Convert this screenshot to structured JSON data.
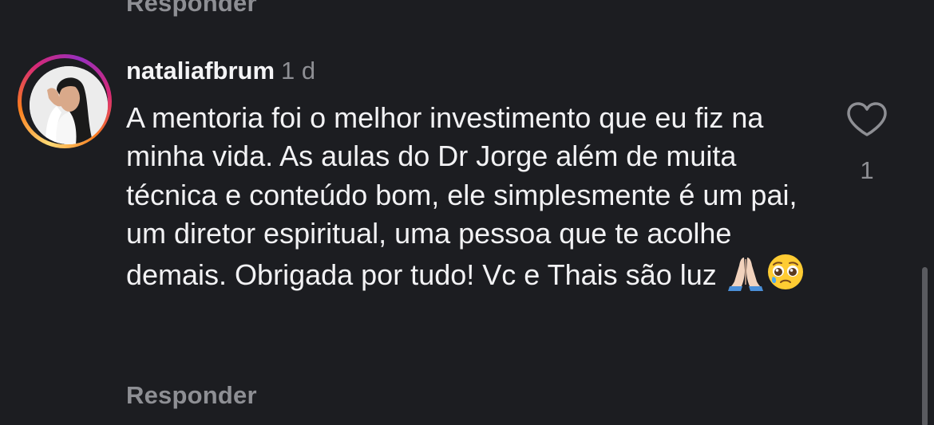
{
  "previous_comment": {
    "reply_label": "Responder"
  },
  "comment": {
    "username": "nataliafbrum",
    "time_ago": "1 d",
    "text": "A mentoria foi o melhor investimento que eu fiz na minha vida. As aulas do Dr Jorge além de muita técnica e conteúdo bom, ele simplesmente é um pai, um diretor espiritual, uma pessoa que te acolhe demais. Obrigada por tudo! Vc e Thais são luz",
    "emojis": [
      "praying-hands-emoji",
      "pleading-face-emoji"
    ],
    "like_icon": "heart-outline-icon",
    "like_count": "1",
    "reply_label": "Responder"
  },
  "colors": {
    "background": "#1c1d21",
    "text_primary": "#f2f2f4",
    "text_secondary": "#8e8f94",
    "story_ring": [
      "#feda75",
      "#fa7e1e",
      "#d62976",
      "#962fbf"
    ]
  }
}
